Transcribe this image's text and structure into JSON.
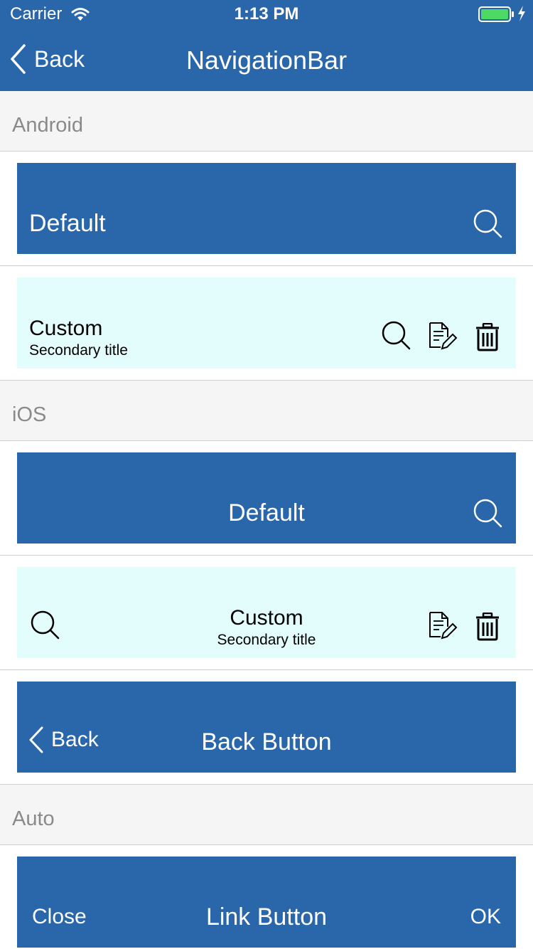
{
  "status_bar": {
    "carrier": "Carrier",
    "time": "1:13 PM"
  },
  "header": {
    "back_label": "Back",
    "title": "NavigationBar"
  },
  "sections": {
    "android": {
      "label": "Android",
      "default_bar": {
        "title": "Default"
      },
      "custom_bar": {
        "title": "Custom",
        "subtitle": "Secondary title"
      }
    },
    "ios": {
      "label": "iOS",
      "default_bar": {
        "title": "Default"
      },
      "custom_bar": {
        "title": "Custom",
        "subtitle": "Secondary title"
      },
      "back_bar": {
        "back_label": "Back",
        "title": "Back Button"
      }
    },
    "auto": {
      "label": "Auto",
      "link_bar": {
        "left_label": "Close",
        "title": "Link Button",
        "right_label": "OK"
      }
    }
  },
  "colors": {
    "nav_blue": "#2a66aa",
    "custom_bg": "#e3fdfd",
    "battery_green": "#4cd964"
  }
}
